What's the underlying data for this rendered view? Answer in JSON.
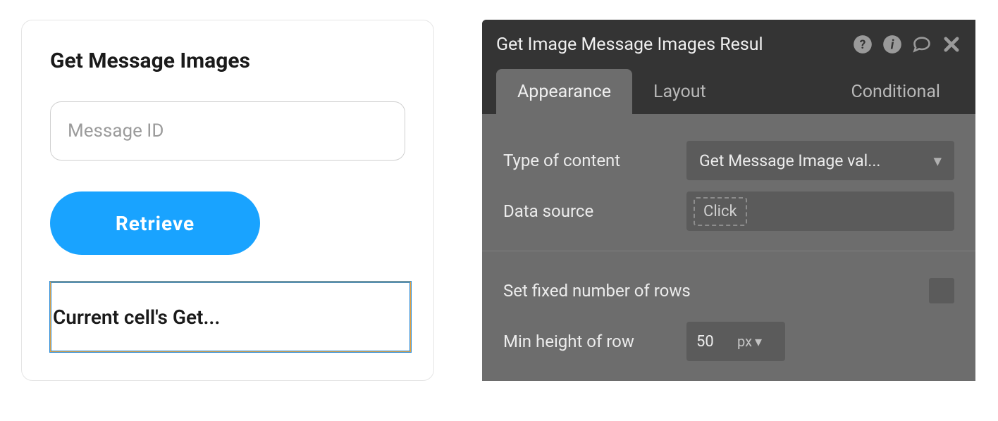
{
  "leftCard": {
    "title": "Get Message Images",
    "messageIdPlaceholder": "Message ID",
    "retrieveLabel": "Retrieve",
    "currentCellText": "Current cell's Get..."
  },
  "panel": {
    "title": "Get Image Message Images Resul",
    "tabs": {
      "appearance": "Appearance",
      "layout": "Layout",
      "conditional": "Conditional"
    },
    "props": {
      "typeOfContentLabel": "Type of content",
      "typeOfContentValue": "Get Message Image val...",
      "dataSourceLabel": "Data source",
      "dataSourceValue": "Click",
      "setFixedRowsLabel": "Set fixed number of rows",
      "minHeightLabel": "Min height of row",
      "minHeightValue": "50",
      "minHeightUnit": "px"
    }
  }
}
